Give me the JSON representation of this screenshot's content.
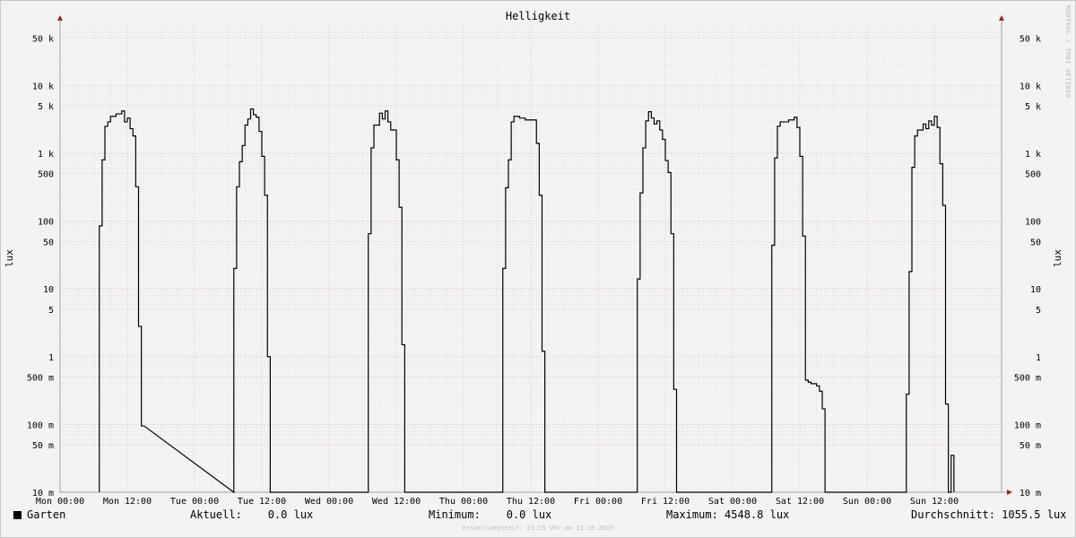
{
  "chart_data": {
    "type": "line",
    "title": "Helligkeit",
    "ylabel": "lux",
    "y_scale": "log",
    "ylim": [
      0.01,
      80000
    ],
    "xlim": [
      0,
      168
    ],
    "x_unit": "hours since Mon 00:00",
    "x_ticks": [
      {
        "pos": 0,
        "label": "Mon 00:00"
      },
      {
        "pos": 12,
        "label": "Mon 12:00"
      },
      {
        "pos": 24,
        "label": "Tue 00:00"
      },
      {
        "pos": 36,
        "label": "Tue 12:00"
      },
      {
        "pos": 48,
        "label": "Wed 00:00"
      },
      {
        "pos": 60,
        "label": "Wed 12:00"
      },
      {
        "pos": 72,
        "label": "Thu 00:00"
      },
      {
        "pos": 84,
        "label": "Thu 12:00"
      },
      {
        "pos": 96,
        "label": "Fri 00:00"
      },
      {
        "pos": 108,
        "label": "Fri 12:00"
      },
      {
        "pos": 120,
        "label": "Sat 00:00"
      },
      {
        "pos": 132,
        "label": "Sat 12:00"
      },
      {
        "pos": 144,
        "label": "Sun 00:00"
      },
      {
        "pos": 156,
        "label": "Sun 12:00"
      }
    ],
    "y_ticks": [
      {
        "v": 50000,
        "label": "50 k"
      },
      {
        "v": 10000,
        "label": "10 k"
      },
      {
        "v": 5000,
        "label": "5 k"
      },
      {
        "v": 1000,
        "label": "1 k"
      },
      {
        "v": 500,
        "label": "500"
      },
      {
        "v": 100,
        "label": "100"
      },
      {
        "v": 50,
        "label": "50"
      },
      {
        "v": 10,
        "label": "10"
      },
      {
        "v": 5,
        "label": "5"
      },
      {
        "v": 1,
        "label": "1"
      },
      {
        "v": 0.5,
        "label": "500 m"
      },
      {
        "v": 0.1,
        "label": "100 m"
      },
      {
        "v": 0.05,
        "label": "50 m"
      },
      {
        "v": 0.01,
        "label": "10 m"
      }
    ],
    "grid": true,
    "series": [
      {
        "name": "Garten",
        "color": "#000000",
        "steps": [
          [
            7.0,
            0.01
          ],
          [
            7.0,
            85
          ],
          [
            7.5,
            85
          ],
          [
            7.5,
            800
          ],
          [
            8.0,
            800
          ],
          [
            8.0,
            2500
          ],
          [
            8.5,
            2500
          ],
          [
            8.5,
            2900
          ],
          [
            9.0,
            2900
          ],
          [
            9.0,
            3500
          ],
          [
            10.0,
            3500
          ],
          [
            10.0,
            3800
          ],
          [
            11.0,
            3800
          ],
          [
            11.0,
            4200
          ],
          [
            11.5,
            4200
          ],
          [
            11.5,
            2900
          ],
          [
            12.0,
            2900
          ],
          [
            12.0,
            3300
          ],
          [
            12.5,
            3300
          ],
          [
            12.5,
            2300
          ],
          [
            13.0,
            2300
          ],
          [
            13.0,
            1800
          ],
          [
            13.5,
            1800
          ],
          [
            13.5,
            320
          ],
          [
            14.0,
            320
          ],
          [
            14.0,
            2.8
          ],
          [
            14.5,
            2.8
          ],
          [
            14.5,
            0.095
          ],
          [
            15.0,
            0.095
          ],
          [
            31.0,
            0.01
          ],
          [
            31.0,
            20
          ],
          [
            31.5,
            20
          ],
          [
            31.5,
            320
          ],
          [
            32.0,
            320
          ],
          [
            32.0,
            750
          ],
          [
            32.5,
            750
          ],
          [
            32.5,
            1300
          ],
          [
            33.0,
            1300
          ],
          [
            33.0,
            2600
          ],
          [
            33.5,
            2600
          ],
          [
            33.5,
            3200
          ],
          [
            34.0,
            3200
          ],
          [
            34.0,
            4500
          ],
          [
            34.5,
            4500
          ],
          [
            34.5,
            3700
          ],
          [
            35.0,
            3700
          ],
          [
            35.0,
            3400
          ],
          [
            35.5,
            3400
          ],
          [
            35.5,
            2100
          ],
          [
            36.0,
            2100
          ],
          [
            36.0,
            900
          ],
          [
            36.5,
            900
          ],
          [
            36.5,
            240
          ],
          [
            37.0,
            240
          ],
          [
            37.0,
            1.0
          ],
          [
            37.5,
            1.0
          ],
          [
            37.5,
            0.01
          ],
          [
            55.0,
            0.01
          ],
          [
            55.0,
            65
          ],
          [
            55.5,
            65
          ],
          [
            55.5,
            1200
          ],
          [
            56.0,
            1200
          ],
          [
            56.0,
            2600
          ],
          [
            57.0,
            2600
          ],
          [
            57.0,
            3900
          ],
          [
            57.5,
            3900
          ],
          [
            57.5,
            3200
          ],
          [
            58.0,
            3200
          ],
          [
            58.0,
            4200
          ],
          [
            58.5,
            4200
          ],
          [
            58.5,
            2900
          ],
          [
            59.0,
            2900
          ],
          [
            59.0,
            2200
          ],
          [
            60.0,
            2200
          ],
          [
            60.0,
            800
          ],
          [
            60.5,
            800
          ],
          [
            60.5,
            160
          ],
          [
            61.0,
            160
          ],
          [
            61.0,
            1.5
          ],
          [
            61.5,
            1.5
          ],
          [
            61.5,
            0.01
          ],
          [
            79.0,
            0.01
          ],
          [
            79.0,
            20
          ],
          [
            79.5,
            20
          ],
          [
            79.5,
            310
          ],
          [
            80.0,
            310
          ],
          [
            80.0,
            800
          ],
          [
            80.5,
            800
          ],
          [
            80.5,
            2900
          ],
          [
            81.0,
            2900
          ],
          [
            81.0,
            3500
          ],
          [
            82.0,
            3500
          ],
          [
            82.0,
            3300
          ],
          [
            83.0,
            3300
          ],
          [
            83.0,
            3100
          ],
          [
            85.0,
            3100
          ],
          [
            85.0,
            1400
          ],
          [
            85.5,
            1400
          ],
          [
            85.5,
            240
          ],
          [
            86.0,
            240
          ],
          [
            86.0,
            1.2
          ],
          [
            86.5,
            1.2
          ],
          [
            86.5,
            0.01
          ],
          [
            103.0,
            0.01
          ],
          [
            103.0,
            14
          ],
          [
            103.5,
            14
          ],
          [
            103.5,
            260
          ],
          [
            104.0,
            260
          ],
          [
            104.0,
            1200
          ],
          [
            104.5,
            1200
          ],
          [
            104.5,
            3000
          ],
          [
            105.0,
            3000
          ],
          [
            105.0,
            4100
          ],
          [
            105.5,
            4100
          ],
          [
            105.5,
            3300
          ],
          [
            106.0,
            3300
          ],
          [
            106.0,
            2700
          ],
          [
            106.5,
            2700
          ],
          [
            106.5,
            3000
          ],
          [
            107.0,
            3000
          ],
          [
            107.0,
            2200
          ],
          [
            107.5,
            2200
          ],
          [
            107.5,
            1600
          ],
          [
            108.0,
            1600
          ],
          [
            108.0,
            780
          ],
          [
            108.5,
            780
          ],
          [
            108.5,
            520
          ],
          [
            109.0,
            520
          ],
          [
            109.0,
            65
          ],
          [
            109.5,
            65
          ],
          [
            109.5,
            0.33
          ],
          [
            110.0,
            0.33
          ],
          [
            110.0,
            0.01
          ],
          [
            127.0,
            0.01
          ],
          [
            127.0,
            44
          ],
          [
            127.5,
            44
          ],
          [
            127.5,
            850
          ],
          [
            128.0,
            850
          ],
          [
            128.0,
            2500
          ],
          [
            128.5,
            2500
          ],
          [
            128.5,
            2900
          ],
          [
            130.0,
            2900
          ],
          [
            130.0,
            3100
          ],
          [
            131.0,
            3100
          ],
          [
            131.0,
            3400
          ],
          [
            131.5,
            3400
          ],
          [
            131.5,
            2400
          ],
          [
            132.0,
            2400
          ],
          [
            132.0,
            900
          ],
          [
            132.5,
            900
          ],
          [
            132.5,
            60
          ],
          [
            133.0,
            60
          ],
          [
            133.0,
            0.45
          ],
          [
            133.5,
            0.45
          ],
          [
            133.5,
            0.42
          ],
          [
            134.0,
            0.42
          ],
          [
            134.0,
            0.4
          ],
          [
            135.0,
            0.4
          ],
          [
            135.0,
            0.37
          ],
          [
            135.5,
            0.37
          ],
          [
            135.5,
            0.31
          ],
          [
            136.0,
            0.31
          ],
          [
            136.0,
            0.17
          ],
          [
            136.5,
            0.17
          ],
          [
            136.5,
            0.01
          ],
          [
            151.0,
            0.01
          ],
          [
            151.0,
            0.28
          ],
          [
            151.5,
            0.28
          ],
          [
            151.5,
            18
          ],
          [
            152.0,
            18
          ],
          [
            152.0,
            620
          ],
          [
            152.5,
            620
          ],
          [
            152.5,
            1800
          ],
          [
            153.0,
            1800
          ],
          [
            153.0,
            2200
          ],
          [
            154.0,
            2200
          ],
          [
            154.0,
            2700
          ],
          [
            154.5,
            2700
          ],
          [
            154.5,
            2300
          ],
          [
            155.0,
            2300
          ],
          [
            155.0,
            3000
          ],
          [
            155.5,
            3000
          ],
          [
            155.5,
            2600
          ],
          [
            156.0,
            2600
          ],
          [
            156.0,
            3500
          ],
          [
            156.5,
            3500
          ],
          [
            156.5,
            2400
          ],
          [
            157.0,
            2400
          ],
          [
            157.0,
            700
          ],
          [
            157.5,
            700
          ],
          [
            157.5,
            170
          ],
          [
            158.0,
            170
          ],
          [
            158.0,
            0.2
          ],
          [
            158.5,
            0.2
          ],
          [
            158.5,
            0.01
          ],
          [
            159.0,
            0.01
          ],
          [
            159.0,
            0.035
          ],
          [
            159.5,
            0.035
          ],
          [
            159.5,
            0.01
          ]
        ]
      }
    ]
  },
  "side_text": "RRDTOOL / TOBI OETIKER",
  "legend": {
    "series_name": "Garten",
    "aktuell": "Aktuell:    0.0 lux",
    "minimum": "Minimum:    0.0 lux",
    "maximum": "Maximum: 4548.8 lux",
    "durchschnitt": "Durchschnitt: 1055.5 lux"
  },
  "footer": "Erstellungszeit: 23:55 Uhr am 13.10.2019"
}
